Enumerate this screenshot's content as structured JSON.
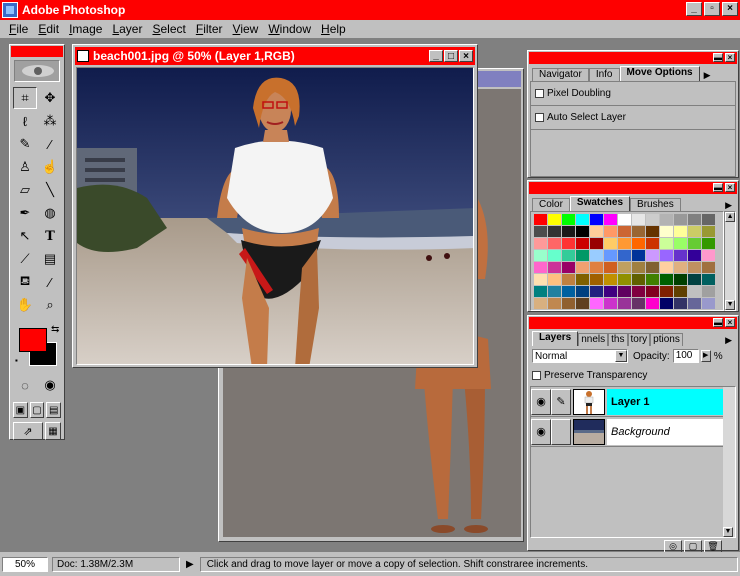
{
  "app": {
    "title": "Adobe Photoshop"
  },
  "window_buttons": [
    "_",
    "▫",
    "×"
  ],
  "menus": [
    "File",
    "Edit",
    "Image",
    "Layer",
    "Select",
    "Filter",
    "View",
    "Window",
    "Help"
  ],
  "document": {
    "title": "beach001.jpg @ 50% (Layer 1,RGB)"
  },
  "tools": [
    "marquee-tool",
    "move-tool",
    "lasso-tool",
    "magic-wand-tool",
    "airbrush-tool",
    "paintbrush-tool",
    "rubber-stamp-tool",
    "smudge-tool",
    "eraser-tool",
    "line-tool",
    "pen-tool",
    "blur-tool",
    "path-select-tool",
    "type-tool",
    "gradient-tool",
    "measure-tool",
    "paint-bucket-tool",
    "eyedropper-tool",
    "hand-tool",
    "zoom-tool"
  ],
  "colors": {
    "foreground": "#ff0000",
    "background": "#000000",
    "accent_title": "#fe0000",
    "layer_selected": "#00ffff"
  },
  "navigator_panel": {
    "tabs": [
      "Navigator",
      "Info",
      "Move Options"
    ],
    "active_tab": "Move Options",
    "options": [
      "Pixel Doubling",
      "Auto Select Layer"
    ]
  },
  "swatches_panel": {
    "tabs": [
      "Color",
      "Swatches",
      "Brushes"
    ],
    "active_tab": "Swatches",
    "swatches": [
      "#ff0000",
      "#ffff00",
      "#00ff00",
      "#00ffff",
      "#0000ff",
      "#ff00ff",
      "#ffffff",
      "#e6e6e6",
      "#cccccc",
      "#b3b3b3",
      "#999999",
      "#808080",
      "#666666",
      "#4d4d4d",
      "#333333",
      "#1a1a1a",
      "#000000",
      "#ffcc99",
      "#ff9966",
      "#cc6633",
      "#996633",
      "#663300",
      "#ffffcc",
      "#ffff99",
      "#cccc66",
      "#999933",
      "#ff9999",
      "#ff6666",
      "#ff3333",
      "#cc0000",
      "#990000",
      "#ffcc66",
      "#ff9933",
      "#ff6600",
      "#cc3300",
      "#ccff99",
      "#99ff66",
      "#66cc33",
      "#339900",
      "#99ffcc",
      "#66ffcc",
      "#33cc99",
      "#009966",
      "#99ccff",
      "#6699ff",
      "#3366cc",
      "#003399",
      "#cc99ff",
      "#9966ff",
      "#6633cc",
      "#330099",
      "#ff99cc",
      "#ff66cc",
      "#cc3399",
      "#990066",
      "#f0a070",
      "#e08040",
      "#d06020",
      "#c0a060",
      "#a08040",
      "#806030",
      "#ffd0a0",
      "#e0b080",
      "#c09060",
      "#a07040",
      "#ffe0b0",
      "#ffc080",
      "#c08040",
      "#806000",
      "#a06000",
      "#c09000",
      "#909000",
      "#606000",
      "#408000",
      "#006000",
      "#004000",
      "#004040",
      "#006060",
      "#008080",
      "#2080a0",
      "#0060a0",
      "#004080",
      "#202080",
      "#400080",
      "#600060",
      "#800040",
      "#800020",
      "#802000",
      "#604000",
      "#c0c0c0",
      "#a0a0a0",
      "#d8b080",
      "#c08850",
      "#906030",
      "#604020",
      "#ff66ff",
      "#cc33cc",
      "#993399",
      "#663366",
      "#ff00cc",
      "#000066",
      "#333366",
      "#666699",
      "#9999cc"
    ]
  },
  "layers_panel": {
    "tabs": [
      "Layers",
      "nnels",
      "ths",
      "tory",
      "ptions"
    ],
    "active_tab": "Layers",
    "blend_mode": "Normal",
    "opacity_label": "Opacity:",
    "opacity_value": "100",
    "opacity_unit": "%",
    "preserve_transparency": "Preserve Transparency",
    "layers": [
      {
        "name": "Layer 1",
        "selected": true
      },
      {
        "name": "Background",
        "selected": false
      }
    ]
  },
  "status": {
    "zoom": "50%",
    "doc_size": "Doc: 1.38M/2.3M",
    "hint": "Click and drag to move layer or move a copy of selection. Shift constraree increments."
  }
}
